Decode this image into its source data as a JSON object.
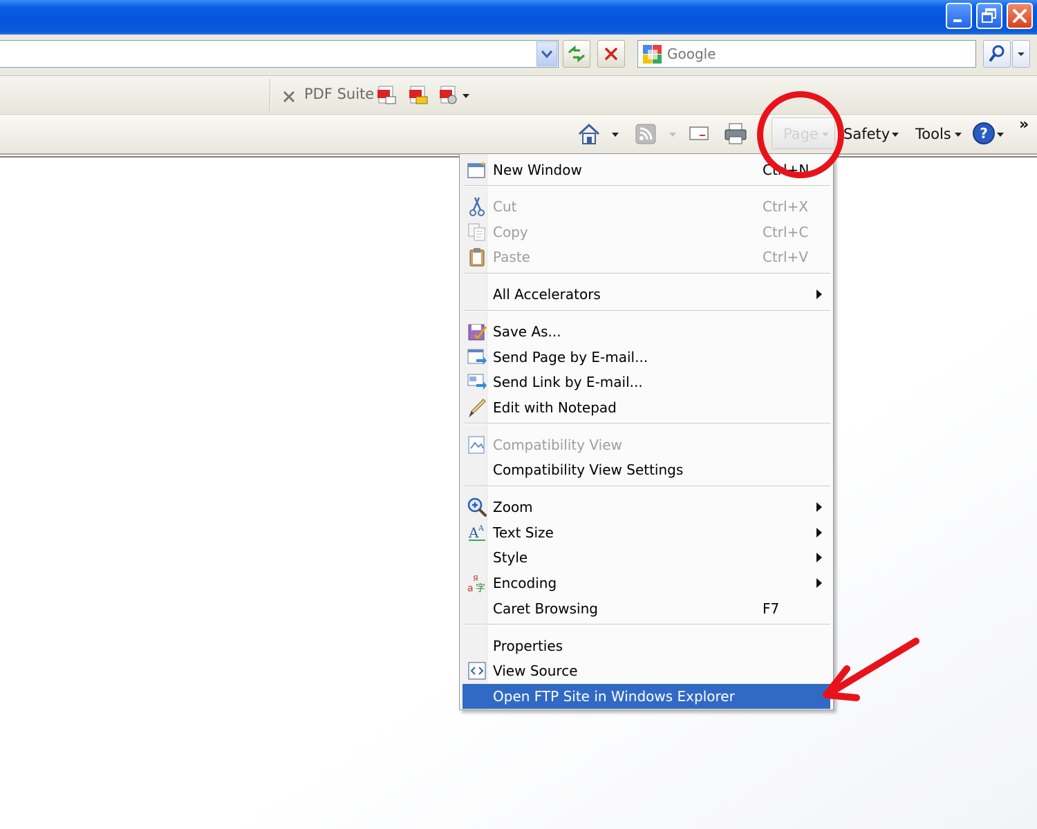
{
  "search": {
    "placeholder": "Google"
  },
  "pdf_toolbar": {
    "label": "PDF Suite"
  },
  "command_bar": {
    "page_label": "Page",
    "safety_label": "Safety",
    "tools_label": "Tools",
    "more_label": "»"
  },
  "menu": {
    "items": [
      {
        "label": "New Window",
        "shortcut": "Ctrl+N",
        "icon": "new-window-icon"
      },
      {
        "label": "Cut",
        "shortcut": "Ctrl+X",
        "icon": "scissors-icon",
        "disabled": true
      },
      {
        "label": "Copy",
        "shortcut": "Ctrl+C",
        "icon": "copy-icon",
        "disabled": true
      },
      {
        "label": "Paste",
        "shortcut": "Ctrl+V",
        "icon": "clipboard-icon",
        "disabled": true
      },
      {
        "label": "All Accelerators",
        "submenu": true
      },
      {
        "label": "Save As...",
        "icon": "save-as-icon"
      },
      {
        "label": "Send Page by E-mail...",
        "icon": "send-page-icon"
      },
      {
        "label": "Send Link by E-mail...",
        "icon": "send-link-icon"
      },
      {
        "label": "Edit with Notepad",
        "icon": "pencil-icon"
      },
      {
        "label": "Compatibility View",
        "icon": "compatibility-view-icon",
        "disabled": true
      },
      {
        "label": "Compatibility View Settings"
      },
      {
        "label": "Zoom",
        "icon": "zoom-icon",
        "submenu": true
      },
      {
        "label": "Text Size",
        "icon": "text-size-icon",
        "submenu": true
      },
      {
        "label": "Style",
        "submenu": true
      },
      {
        "label": "Encoding",
        "icon": "encoding-icon",
        "submenu": true
      },
      {
        "label": "Caret Browsing",
        "shortcut": "F7"
      },
      {
        "label": "Properties"
      },
      {
        "label": "View Source",
        "icon": "view-source-icon"
      },
      {
        "label": "Open FTP Site in Windows Explorer",
        "selected": true
      }
    ]
  },
  "colors": {
    "highlight": "#316ac5",
    "annotation": "#e8121b",
    "titlebar": "#0554e0"
  }
}
